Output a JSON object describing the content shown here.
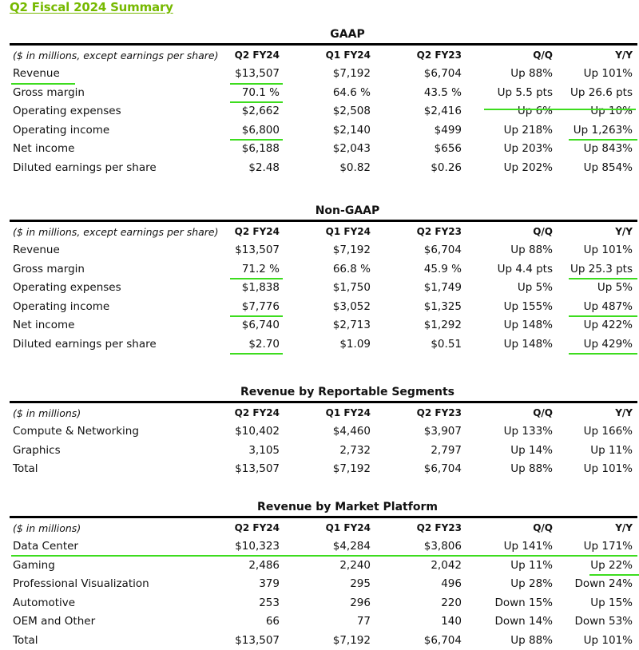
{
  "title": "Q2 Fiscal 2024 Summary",
  "colors": {
    "accent": "#76b900",
    "highlight": "#3ddc1e"
  },
  "gaap": {
    "title": "GAAP",
    "header": [
      "($ in millions, except earnings per share)",
      "Q2 FY24",
      "Q1 FY24",
      "Q2 FY23",
      "Q/Q",
      "Y/Y"
    ],
    "rows": [
      [
        "Revenue",
        "$13,507",
        "$7,192",
        "$6,704",
        "Up 88%",
        "Up 101%"
      ],
      [
        "Gross margin",
        "70.1 %",
        "64.6 %",
        "43.5 %",
        "Up 5.5 pts",
        "Up 26.6 pts"
      ],
      [
        "Operating expenses",
        "$2,662",
        "$2,508",
        "$2,416",
        "Up 6%",
        "Up 10%"
      ],
      [
        "Operating income",
        "$6,800",
        "$2,140",
        "$499",
        "Up 218%",
        "Up 1,263%"
      ],
      [
        "Net income",
        "$6,188",
        "$2,043",
        "$656",
        "Up 203%",
        "Up 843%"
      ],
      [
        "Diluted earnings per share",
        "$2.48",
        "$0.82",
        "$0.26",
        "Up 202%",
        "Up 854%"
      ]
    ]
  },
  "non_gaap": {
    "title": "Non-GAAP",
    "header": [
      "($ in millions, except earnings per share)",
      "Q2 FY24",
      "Q1 FY24",
      "Q2 FY23",
      "Q/Q",
      "Y/Y"
    ],
    "rows": [
      [
        "Revenue",
        "$13,507",
        "$7,192",
        "$6,704",
        "Up 88%",
        "Up 101%"
      ],
      [
        "Gross margin",
        "71.2 %",
        "66.8 %",
        "45.9 %",
        "Up 4.4 pts",
        "Up 25.3 pts"
      ],
      [
        "Operating expenses",
        "$1,838",
        "$1,750",
        "$1,749",
        "Up 5%",
        "Up 5%"
      ],
      [
        "Operating income",
        "$7,776",
        "$3,052",
        "$1,325",
        "Up 155%",
        "Up 487%"
      ],
      [
        "Net income",
        "$6,740",
        "$2,713",
        "$1,292",
        "Up 148%",
        "Up 422%"
      ],
      [
        "Diluted earnings per share",
        "$2.70",
        "$1.09",
        "$0.51",
        "Up 148%",
        "Up 429%"
      ]
    ]
  },
  "segments": {
    "title": "Revenue by Reportable Segments",
    "header": [
      "($ in millions)",
      "Q2 FY24",
      "Q1 FY24",
      "Q2 FY23",
      "Q/Q",
      "Y/Y"
    ],
    "rows": [
      [
        "Compute & Networking",
        "$10,402",
        "$4,460",
        "$3,907",
        "Up 133%",
        "Up 166%"
      ],
      [
        "Graphics",
        "3,105",
        "2,732",
        "2,797",
        "Up 14%",
        "Up 11%"
      ],
      [
        "Total",
        "$13,507",
        "$7,192",
        "$6,704",
        "Up 88%",
        "Up 101%"
      ]
    ]
  },
  "platforms": {
    "title": "Revenue by Market Platform",
    "header": [
      "($ in millions)",
      "Q2 FY24",
      "Q1 FY24",
      "Q2 FY23",
      "Q/Q",
      "Y/Y"
    ],
    "rows": [
      [
        "Data Center",
        "$10,323",
        "$4,284",
        "$3,806",
        "Up 141%",
        "Up 171%"
      ],
      [
        "Gaming",
        "2,486",
        "2,240",
        "2,042",
        "Up 11%",
        "Up 22%"
      ],
      [
        "Professional Visualization",
        "379",
        "295",
        "496",
        "Up 28%",
        "Down 24%"
      ],
      [
        "Automotive",
        "253",
        "296",
        "220",
        "Down 15%",
        "Up 15%"
      ],
      [
        "OEM and Other",
        "66",
        "77",
        "140",
        "Down 14%",
        "Down 53%"
      ],
      [
        "Total",
        "$13,507",
        "$7,192",
        "$6,704",
        "Up 88%",
        "Up 101%"
      ]
    ]
  }
}
